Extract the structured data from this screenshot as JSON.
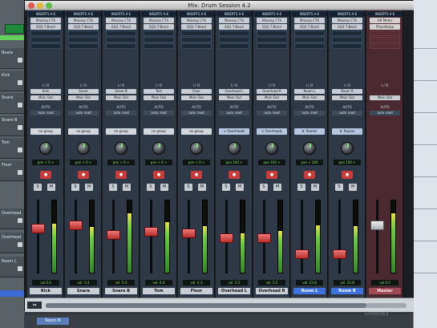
{
  "window": {
    "title": "Mix: Drum Session 4.2"
  },
  "sidebar": {
    "items": [
      "Beats",
      "Kick",
      "Snare",
      "Snare B",
      "Tom",
      "Floor",
      "Overhead L",
      "Overhead R",
      "Room L"
    ]
  },
  "labels": {
    "inserts": "INSERTS A-E",
    "io": "I / O",
    "auto": "AUTO",
    "pan": "pan",
    "vol": "vol"
  },
  "strips": [
    {
      "name": "Kick",
      "inserts": [
        "Massey CT4",
        "EQ3 7-Band"
      ],
      "input": "Kick",
      "output": "Main Out",
      "auto": "auto read",
      "group": "no group",
      "pan": "< 0 >",
      "vol": "0.0",
      "fader": 0.62,
      "meter": 0.68,
      "highlight": false
    },
    {
      "name": "Snare",
      "inserts": [
        "Massey CT4",
        "EQ3 7-Band"
      ],
      "input": "Snare",
      "output": "Main Out",
      "auto": "auto read",
      "group": "no group",
      "pan": "< 0 >",
      "vol": "-3.4",
      "fader": 0.68,
      "meter": 0.63,
      "highlight": false
    },
    {
      "name": "Snare B",
      "inserts": [
        "Massey CT4",
        "EQ3 7-Band"
      ],
      "input": "Snare B",
      "output": "Main Out",
      "auto": "auto read",
      "group": "no group",
      "pan": "< 0 >",
      "vol": "-5.0",
      "fader": 0.52,
      "meter": 0.82,
      "highlight": false
    },
    {
      "name": "Tom",
      "inserts": [
        "Massey CT4",
        "EQ3 7-Band"
      ],
      "input": "Tom",
      "output": "Main Out",
      "auto": "auto read",
      "group": "no group",
      "pan": "< 0 >",
      "vol": "-4.0",
      "fader": 0.58,
      "meter": 0.7,
      "highlight": false
    },
    {
      "name": "Floor",
      "inserts": [
        "Massey CT4",
        "EQ3 7-Band"
      ],
      "input": "Floor",
      "output": "Main Out",
      "auto": "auto read",
      "group": "no group",
      "pan": "< 0 >",
      "vol": "-4.3",
      "fader": 0.55,
      "meter": 0.65,
      "highlight": false
    },
    {
      "name": "Overhead L",
      "inserts": [
        "Massey CT4",
        "EQ3 7-Band"
      ],
      "input": "Overhead L",
      "output": "Main Out",
      "auto": "auto read",
      "group": "< Overheads",
      "pan": "100 >",
      "vol": "-5.5",
      "fader": 0.48,
      "meter": 0.55,
      "highlight": false
    },
    {
      "name": "Overhead R",
      "inserts": [
        "Massey CT4",
        "EQ3 7-Band"
      ],
      "input": "Overhead R",
      "output": "Main Out",
      "auto": "auto read",
      "group": "< Overheads",
      "pan": "100 >",
      "vol": "-5.5",
      "fader": 0.47,
      "meter": 0.58,
      "highlight": false
    },
    {
      "name": "Room L",
      "inserts": [
        "Massey CT4",
        "EQ3 7-Band"
      ],
      "input": "Room L",
      "output": "Main Out",
      "auto": "auto read",
      "group": "b: Rooms",
      "pan": "< 100",
      "vol": "-23.8",
      "fader": 0.22,
      "meter": 0.66,
      "highlight": true
    },
    {
      "name": "Room R",
      "inserts": [
        "Massey CT4",
        "EQ3 7-Band"
      ],
      "input": "Room R",
      "output": "Main Out",
      "auto": "auto read",
      "group": "b: Rooms",
      "pan": "100 >",
      "vol": "-23.8",
      "fader": 0.23,
      "meter": 0.64,
      "highlight": true
    }
  ],
  "master": {
    "name": "Master",
    "inserts": [
      "HR Meter",
      "Phaseltoop"
    ],
    "output": "Main Out",
    "auto": "auto read",
    "vol": "0.0",
    "fader": 0.68,
    "meter": 0.82
  },
  "bottom": {
    "track_name": "Room R"
  },
  "watermark": "Groove3"
}
